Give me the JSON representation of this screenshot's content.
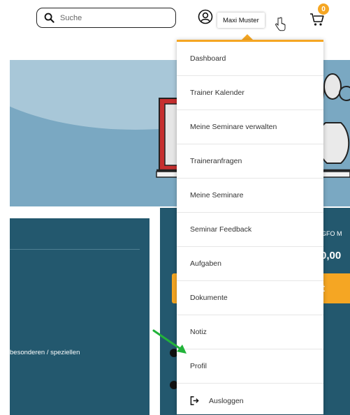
{
  "header": {
    "search": {
      "placeholder": "Suche"
    },
    "user_name": "Maxi Muster",
    "cart_count": "0"
  },
  "menu": {
    "items": [
      {
        "label": "Dashboard"
      },
      {
        "label": "Trainer Kalender"
      },
      {
        "label": "Meine Seminare verwalten"
      },
      {
        "label": "Traineranfragen"
      },
      {
        "label": "Meine Seminare"
      },
      {
        "label": "Seminar Feedback"
      },
      {
        "label": "Aufgaben"
      },
      {
        "label": "Dokumente"
      },
      {
        "label": "Notiz"
      },
      {
        "label": "Profil"
      },
      {
        "label": "Ausloggen",
        "icon": "logout-icon"
      }
    ]
  },
  "background": {
    "left_panel_text": "besonderen / speziellen",
    "right_panel_text1": "GFO M",
    "right_panel_text2": "0,00",
    "right_panel_button": "t"
  },
  "colors": {
    "accent": "#f5a623",
    "panel": "#23586e",
    "banner": "#7aa8c2",
    "arrow": "#22b33a"
  }
}
